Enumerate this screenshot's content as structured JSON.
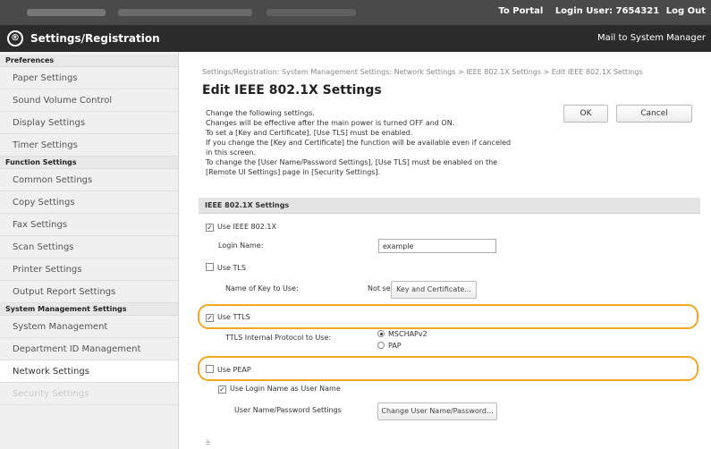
{
  "topbar": {
    "portal_link": "To Portal",
    "login_user": "Login User: 7654321",
    "logout": "Log Out"
  },
  "header": {
    "logo_glyph": "®",
    "title": "Settings/Registration",
    "mail_link": "Mail to System Manager"
  },
  "sidebar": {
    "categories": {
      "preferences": "Preferences",
      "function": "Function Settings",
      "system": "System Management Settings"
    },
    "items": {
      "paper": "Paper Settings",
      "sound": "Sound Volume Control",
      "display": "Display Settings",
      "timer": "Timer Settings",
      "common": "Common Settings",
      "copy": "Copy Settings",
      "fax": "Fax Settings",
      "scan": "Scan Settings",
      "printer": "Printer Settings",
      "output_report": "Output Report Settings",
      "system_management": "System Management",
      "department_id": "Department ID Management",
      "network": "Network Settings",
      "security": "Security Settings"
    }
  },
  "main": {
    "breadcrumb": "Settings/Registration: System Management Settings: Network Settings > IEEE 802.1X Settings > Edit IEEE 802.1X Settings",
    "title": "Edit IEEE 802.1X Settings",
    "description": [
      "Change the following settings.",
      "Changes will be effective after the main power is turned OFF and ON.",
      "To set a [Key and Certificate], [Use TLS] must be enabled.",
      "If you change the [Key and Certificate] the function will be available even if canceled",
      "in this screen.",
      "To change the [User Name/Password Settings], [Use TLS] must be enabled on the",
      "[Remote UI Settings] page in [Security Settings]."
    ],
    "ok_label": "OK",
    "cancel_label": "Cancel",
    "section_title": "IEEE 802.1X Settings",
    "use_ieee_label": "Use IEEE 802.1X",
    "login_name_label": "Login Name:",
    "login_name_value": "example",
    "use_tls_label": "Use TLS",
    "key_name_label": "Name of Key to Use:",
    "key_name_value": "Not set",
    "key_cert_button": "Key and Certificate...",
    "use_ttls_label": "Use TTLS",
    "ttls_protocol_label": "TTLS Internal Protocol to Use:",
    "ttls_option_1": "MSCHAPv2",
    "ttls_option_2": "PAP",
    "use_peap_label": "Use PEAP",
    "use_login_name_label": "Use Login Name as User Name",
    "user_pass_label": "User Name/Password Settings",
    "change_user_button": "Change User Name/Password...",
    "checks": {
      "use_ieee": true,
      "use_tls": false,
      "use_ttls": true,
      "use_peap": false,
      "use_login_name": true
    },
    "ttls_selected": "MSCHAPv2",
    "scroll_glyph": "≚"
  },
  "colors": {
    "highlight": "#f5a623",
    "topbar": "#4a4a4a",
    "header": "#2b2b2b"
  }
}
